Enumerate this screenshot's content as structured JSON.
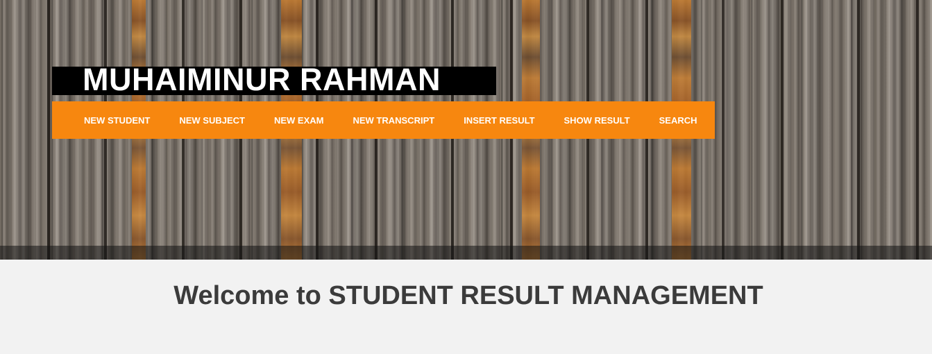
{
  "header": {
    "site_title": "MUHAIMINUR RAHMAN"
  },
  "nav": {
    "items": [
      {
        "label": "NEW STUDENT"
      },
      {
        "label": "NEW SUBJECT"
      },
      {
        "label": "NEW EXAM"
      },
      {
        "label": "NEW TRANSCRIPT"
      },
      {
        "label": "INSERT RESULT"
      },
      {
        "label": "SHOW RESULT"
      },
      {
        "label": "SEARCH"
      }
    ]
  },
  "main": {
    "welcome": "Welcome to STUDENT RESULT MANAGEMENT"
  },
  "colors": {
    "nav_background": "#f7870f",
    "title_background": "#000000",
    "page_background": "#f2f2f2",
    "heading_text": "#3b3b3b"
  }
}
